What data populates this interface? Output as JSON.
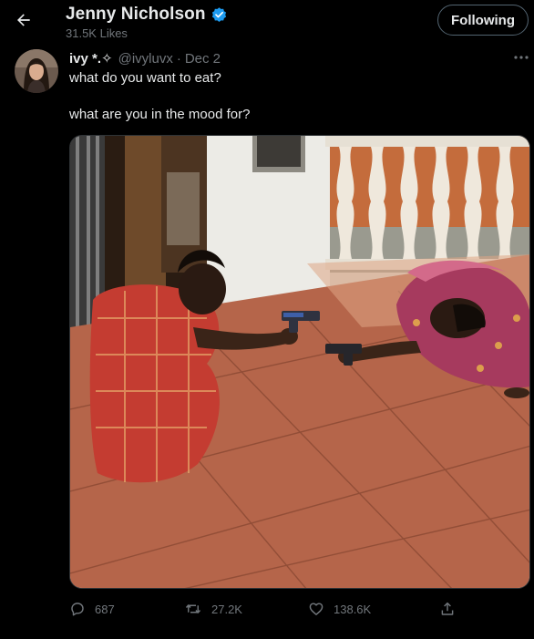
{
  "header": {
    "title": "Jenny Nicholson",
    "likes_count": "31.5K Likes",
    "follow_button_label": "Following",
    "back_icon": "arrow-left-icon",
    "verified_icon": "verified-badge-icon"
  },
  "tweet": {
    "author_name": "ivy *.✧",
    "author_handle": "@ivyluvx",
    "separator": "·",
    "date": "Dec 2",
    "text_line1": "what do you want to eat?",
    "text_line2": "what are you in the mood for?",
    "more_icon": "more-options-icon"
  },
  "actions": {
    "replies": "687",
    "retweets": "27.2K",
    "likes": "138.6K",
    "reply_icon": "reply-bubble-icon",
    "retweet_icon": "retweet-icon",
    "like_icon": "heart-icon",
    "share_icon": "share-icon"
  },
  "colors": {
    "background": "#000000",
    "primary_text": "#e7e9ea",
    "secondary_text": "#71767b",
    "border": "#536471",
    "verified": "#1d9bf0"
  }
}
